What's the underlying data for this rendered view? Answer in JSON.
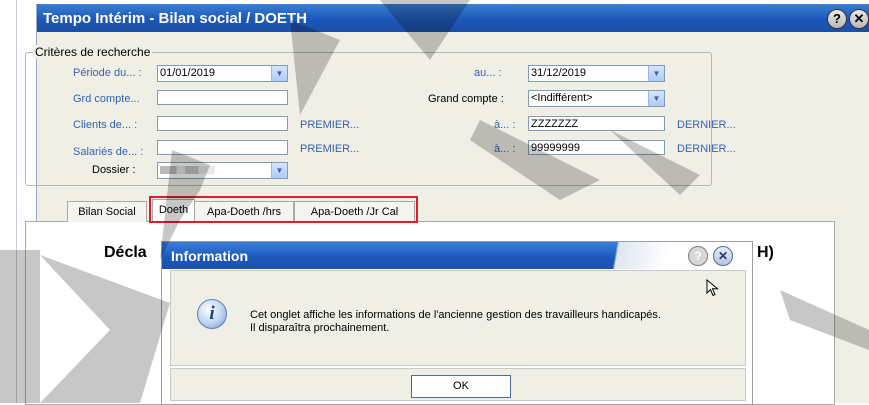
{
  "window": {
    "title": "Tempo Intérim - Bilan social / DOETH",
    "help_label": "?",
    "close_label": "✕"
  },
  "criteria": {
    "legend": "Critères de recherche",
    "periode_label": "Période du... :",
    "periode_from": "01/01/2019",
    "au_label": "au... :",
    "periode_to": "31/12/2019",
    "grd_compte_label": "Grd compte...",
    "grd_compte_value": "",
    "grand_compte_label": "Grand compte :",
    "grand_compte_value": "<Indifférent>",
    "clients_label": "Clients de... :",
    "clients_from": "",
    "premier_label_1": "PREMIER...",
    "a_label_1": "à... :",
    "clients_to": "ZZZZZZZ",
    "dernier_label_1": "DERNIER...",
    "salaries_label": "Salariés de... :",
    "salaries_from": "",
    "premier_label_2": "PREMIER...",
    "a_label_2": "à... :",
    "salaries_to": "99999999",
    "dernier_label_2": "DERNIER...",
    "dossier_label": "Dossier :"
  },
  "tabs": [
    "Bilan Social",
    "Doeth",
    "Apa-Doeth /hrs",
    "Apa-Doeth /Jr Cal"
  ],
  "panel": {
    "heading_start": "Décla",
    "heading_end": "H)"
  },
  "dialog": {
    "title": "Information",
    "help_label": "?",
    "close_label": "✕",
    "icon_glyph": "i",
    "message_line1": "Cet onglet affiche les informations de l'ancienne gestion des travailleurs handicapés.",
    "message_line2": "Il disparaîtra prochainement.",
    "ok_label": "OK"
  },
  "colors": {
    "title_blue": "#1d58b8",
    "link_blue": "#3563b0",
    "highlight_red": "#e01c2c"
  }
}
